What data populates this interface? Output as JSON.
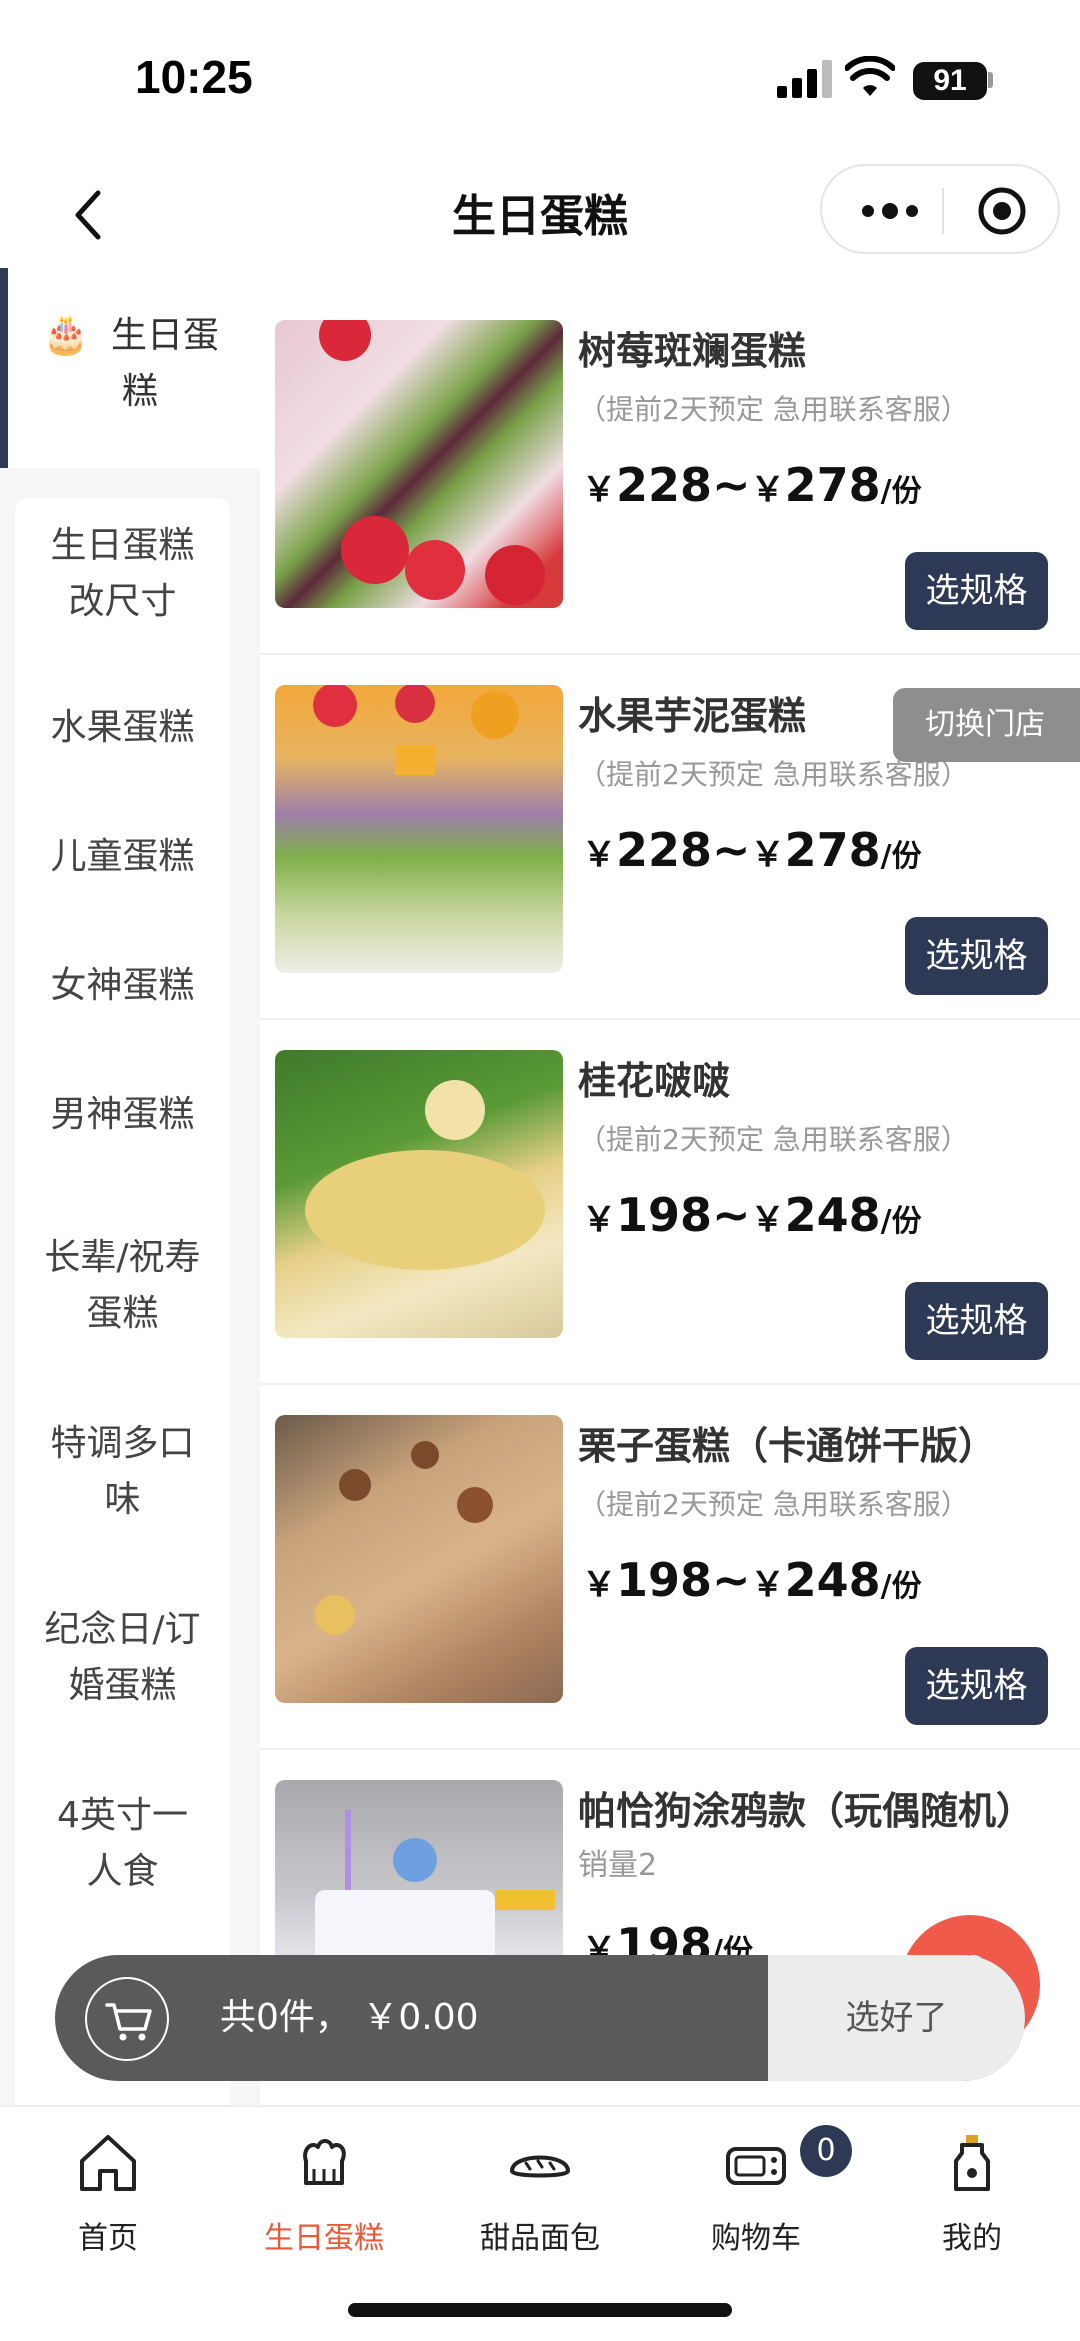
{
  "status_bar": {
    "time": "10:25",
    "battery": "91"
  },
  "navbar": {
    "title": "生日蛋糕"
  },
  "sidebar": {
    "active": {
      "label_line1": "生日蛋",
      "label_line2": "糕",
      "emoji": "🎂"
    },
    "items": [
      {
        "line1": "生日蛋糕",
        "line2": "改尺寸"
      },
      {
        "line1": "水果蛋糕",
        "line2": ""
      },
      {
        "line1": "儿童蛋糕",
        "line2": ""
      },
      {
        "line1": "女神蛋糕",
        "line2": ""
      },
      {
        "line1": "男神蛋糕",
        "line2": ""
      },
      {
        "line1": "长辈/祝寿",
        "line2": "蛋糕"
      },
      {
        "line1": "特调多口",
        "line2": "味"
      },
      {
        "line1": "纪念日/订",
        "line2": "婚蛋糕"
      },
      {
        "line1": "4英寸一",
        "line2": "人食"
      }
    ]
  },
  "products": [
    {
      "name": "树莓斑斓蛋糕",
      "note": "（提前2天预定 急用联系客服）",
      "price_low": "228~",
      "price_high": "278",
      "unit": "/份",
      "currency": "￥",
      "button": "选规格"
    },
    {
      "name": "水果芋泥蛋糕",
      "note": "（提前2天预定 急用联系客服）",
      "price_low": "228~",
      "price_high": "278",
      "unit": "/份",
      "currency": "￥",
      "button": "选规格"
    },
    {
      "name": "桂花啵啵",
      "note": "（提前2天预定 急用联系客服）",
      "price_low": "198~",
      "price_high": "248",
      "unit": "/份",
      "currency": "￥",
      "button": "选规格"
    },
    {
      "name": "栗子蛋糕（卡通饼干版）",
      "note": "（提前2天预定 急用联系客服）",
      "price_low": "198~",
      "price_high": "248",
      "unit": "/份",
      "currency": "￥",
      "button": "选规格"
    },
    {
      "name": "帕恰狗涂鸦款（玩偶随机）",
      "note": "销量2",
      "price_low": "198",
      "price_high": "",
      "unit": "/份",
      "currency": "￥",
      "button": ""
    }
  ],
  "switch_store": "切换门店",
  "cart": {
    "summary": "共0件，  ￥0.00",
    "done": "选好了"
  },
  "tabs": [
    {
      "label": "首页",
      "icon": "home-icon"
    },
    {
      "label": "生日蛋糕",
      "icon": "cake-hat-icon"
    },
    {
      "label": "甜品面包",
      "icon": "bread-icon"
    },
    {
      "label": "购物车",
      "icon": "oven-icon"
    },
    {
      "label": "我的",
      "icon": "bottle-icon"
    }
  ],
  "cart_badge": "0",
  "colors": {
    "accent": "#2e3a55",
    "active_tab": "#e85a3a",
    "fab": "#f05a4a"
  }
}
